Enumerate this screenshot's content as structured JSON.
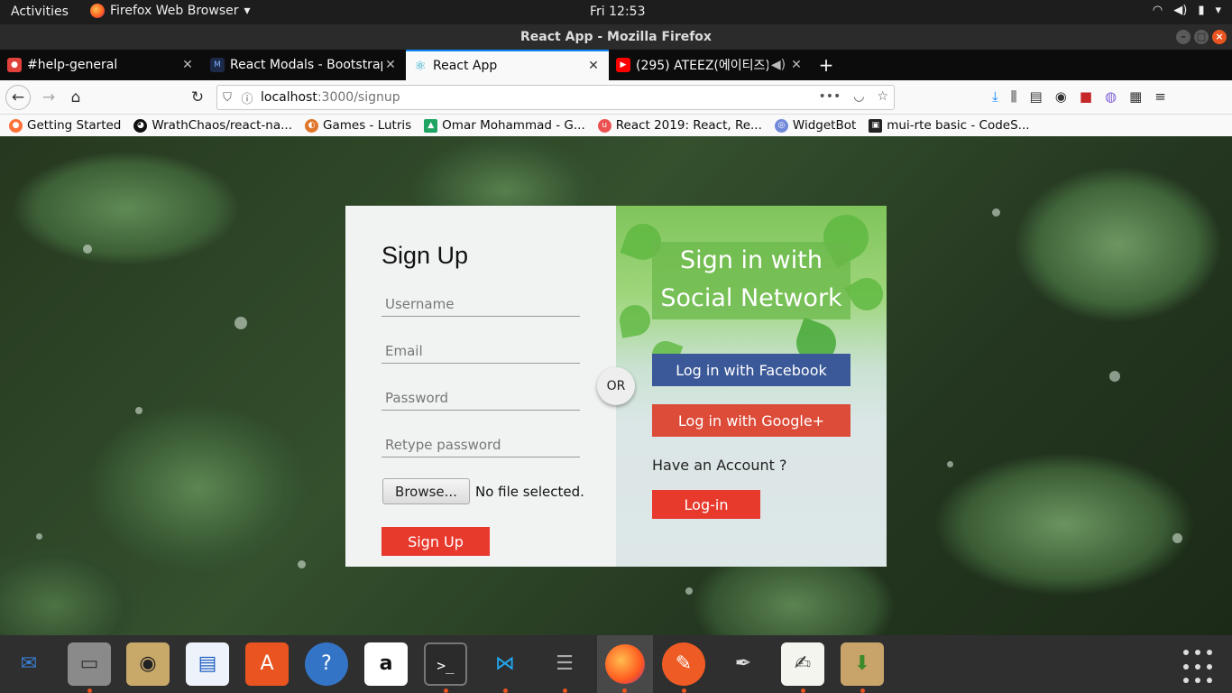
{
  "topbar": {
    "activities": "Activities",
    "app_name": "Firefox Web Browser",
    "app_arrow": "▾",
    "clock": "Fri 12:53",
    "tray": [
      "wifi-icon",
      "volume-icon",
      "battery-icon",
      "power-menu-icon"
    ]
  },
  "window": {
    "title": "React App - Mozilla Firefox"
  },
  "tabs": [
    {
      "label": "#help-general",
      "icon": "discord-favicon",
      "icon_color": "#e0423b"
    },
    {
      "label": "React Modals - Bootstrap",
      "icon": "mdb-favicon",
      "icon_color": "#1c2a48"
    },
    {
      "label": "React App",
      "icon": "react-favicon",
      "icon_color": "#61dafb",
      "active": true
    },
    {
      "label": "(295) ATEEZ(에이티즈) - ",
      "icon": "youtube-favicon",
      "icon_color": "#ff0000",
      "audio": true
    }
  ],
  "urlbar": {
    "host": "localhost",
    "rest": ":3000/signup"
  },
  "bookmarks": [
    {
      "label": "Getting Started",
      "icon": "firefox-icon",
      "color": "#ff7139"
    },
    {
      "label": "WrathChaos/react-na...",
      "icon": "github-icon",
      "color": "#111111"
    },
    {
      "label": "Games - Lutris",
      "icon": "lutris-icon",
      "color": "#e0762a"
    },
    {
      "label": "Omar Mohammad - G...",
      "icon": "google-drive-icon",
      "color": "#1fa463"
    },
    {
      "label": "React 2019: React, Re...",
      "icon": "udemy-icon",
      "color": "#ec5252"
    },
    {
      "label": "WidgetBot",
      "icon": "widgetbot-icon",
      "color": "#7289da"
    },
    {
      "label": "mui-rte basic - CodeS...",
      "icon": "codesandbox-icon",
      "color": "#222222"
    }
  ],
  "signup": {
    "title": "Sign Up",
    "username_placeholder": "Username",
    "email_placeholder": "Email",
    "password_placeholder": "Password",
    "retype_placeholder": "Retype password",
    "browse_label": "Browse...",
    "file_status": "No file selected.",
    "submit_label": "Sign Up"
  },
  "or_label": "OR",
  "social": {
    "title_line1": "Sign in with",
    "title_line2": "Social Network",
    "facebook_label": "Log in with Facebook",
    "google_label": "Log in with Google+",
    "have_account": "Have an Account ?",
    "login_label": "Log-in"
  },
  "colors": {
    "facebook": "#3b5998",
    "google": "#dd4b39",
    "primary_red": "#e8392d",
    "accent": "#0a84ff"
  },
  "dock": [
    {
      "name": "thunderbird-icon",
      "running": false
    },
    {
      "name": "files-icon",
      "running": true
    },
    {
      "name": "rhythmbox-icon",
      "running": false
    },
    {
      "name": "libreoffice-writer-icon",
      "running": false
    },
    {
      "name": "software-center-icon",
      "running": false
    },
    {
      "name": "help-icon",
      "running": false
    },
    {
      "name": "amazon-icon",
      "running": false
    },
    {
      "name": "terminal-icon",
      "running": true
    },
    {
      "name": "vscode-icon",
      "running": true
    },
    {
      "name": "database-icon",
      "running": true
    },
    {
      "name": "firefox-icon",
      "running": true,
      "active": true
    },
    {
      "name": "postman-icon",
      "running": true
    },
    {
      "name": "color-picker-icon",
      "running": false
    },
    {
      "name": "text-editor-icon",
      "running": true
    },
    {
      "name": "archive-manager-icon",
      "running": true
    }
  ]
}
